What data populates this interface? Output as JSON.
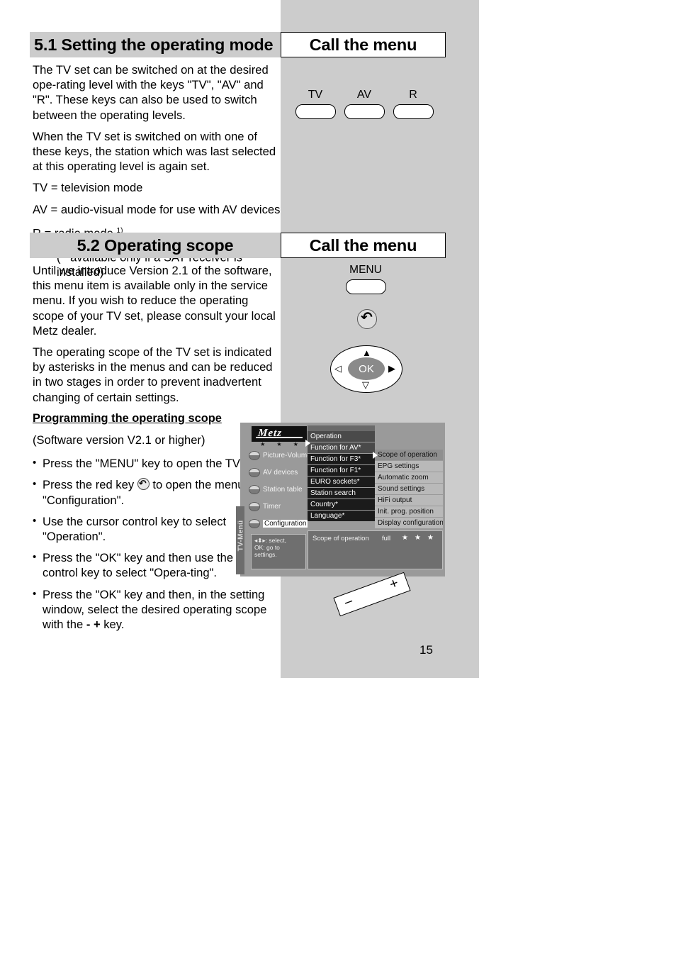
{
  "sections": [
    {
      "number_title": "5.1 Setting the operating mode",
      "right_title": "Call the menu",
      "paragraphs": [
        "The TV set can be switched on at the desired ope-rating level with the keys \"TV\", \"AV\" and \"R\". These keys can also be used to switch between the operating levels.",
        "When the TV set is switched on with one of these keys, the station which was last selected at this operating level is again set.",
        "TV = television mode",
        "AV = audio-visual mode for use with AV devices"
      ],
      "radio_line": "R = radio mode",
      "radio_footnote_marker": "1)",
      "footnote": "available only if a SAT receiver is installed)",
      "footnote_marker": "1)",
      "footnote_open": "("
    },
    {
      "number_title": "5.2 Operating scope",
      "right_title": "Call the menu",
      "paragraphs": [
        "Until we introduce Version 2.1 of the software, this menu item is available only in the service menu. If you wish to reduce the operating scope of your TV set, please consult your local Metz dealer.",
        "The operating scope of the TV set is indicated by asterisks in the menus and can be reduced in two stages in order to prevent inadvertent changing of certain settings."
      ],
      "sub_heading": "Programming the operating scope",
      "sub_note": "(Software version V2.1 or higher)",
      "steps": [
        {
          "before": "Press the \"MENU\" key to open the TV menu.",
          "icon": null,
          "after": ""
        },
        {
          "before": "Press the red key ",
          "icon": "back-arrow-icon",
          "after": " to open the menu \"Configuration\"."
        },
        {
          "before": "Use the cursor control key to select \"Operation\".",
          "icon": null,
          "after": ""
        },
        {
          "before": "Press the \"OK\" key and then use the cursor control key to select \"Opera-ting\".",
          "icon": null,
          "after": ""
        },
        {
          "before": "Press the \"OK\" key and then, in the setting window, select the desired operating scope with the ",
          "icon": "minus-plus-keys",
          "after": " key."
        }
      ],
      "step_last_keys": "- +"
    }
  ],
  "remote": {
    "mode_keys": [
      {
        "label": "TV",
        "name": "tv-key"
      },
      {
        "label": "AV",
        "name": "av-key"
      },
      {
        "label": "R",
        "name": "r-key"
      }
    ],
    "menu_key_label": "MENU",
    "back_key_glyph": "↶",
    "cursor": {
      "ok_label": "OK",
      "up": "▲",
      "down": "▽",
      "left": "◁",
      "right": "▶"
    },
    "volume_rocker": {
      "minus": "–",
      "plus": "+"
    }
  },
  "osd": {
    "vertical_tab": "TV-Menü",
    "logo_text": "Metz",
    "logo_stars": [
      "★",
      "★",
      "★"
    ],
    "sidebar_items": [
      {
        "label": "Picture-Volume",
        "selected": false
      },
      {
        "label": "AV devices",
        "selected": false
      },
      {
        "label": "Station table",
        "selected": false
      },
      {
        "label": "Timer",
        "selected": false
      },
      {
        "label": "Configuration",
        "selected": true
      }
    ],
    "hint": "◀▲▶: select,\nOK: go to\nsettings.",
    "hint_lines": [
      "◂⬍▸: select,",
      "OK: go to",
      "settings."
    ],
    "middle_menu": [
      {
        "label": "Operation",
        "highlight": true
      },
      {
        "label": "Function for AV*",
        "highlight": true
      },
      {
        "label": "Function for F3*",
        "highlight": false
      },
      {
        "label": "Function for F1*",
        "highlight": false
      },
      {
        "label": "EURO sockets*",
        "highlight": false
      },
      {
        "label": "Station search",
        "highlight": false
      },
      {
        "label": "Country*",
        "highlight": false
      },
      {
        "label": "Language*",
        "highlight": false
      }
    ],
    "right_menu": [
      {
        "label": "Scope of operation",
        "highlight": true
      },
      {
        "label": "EPG settings",
        "highlight": false
      },
      {
        "label": "Automatic zoom",
        "highlight": false
      },
      {
        "label": "Sound settings",
        "highlight": false
      },
      {
        "label": "HiFi output",
        "highlight": false
      },
      {
        "label": "Init. prog. position",
        "highlight": false
      },
      {
        "label": "Display configuration",
        "highlight": false
      }
    ],
    "status": {
      "label": "Scope of operation",
      "value": "full",
      "stars": [
        "★",
        "★",
        "★"
      ]
    }
  },
  "page_number": "15",
  "colors": {
    "band_grey": "#cccccc",
    "panel_grey": "#cccccc",
    "osd_bg": "#9a9a9a",
    "osd_dark": "#1b1b1b",
    "osd_light": "#b9b9b9"
  }
}
